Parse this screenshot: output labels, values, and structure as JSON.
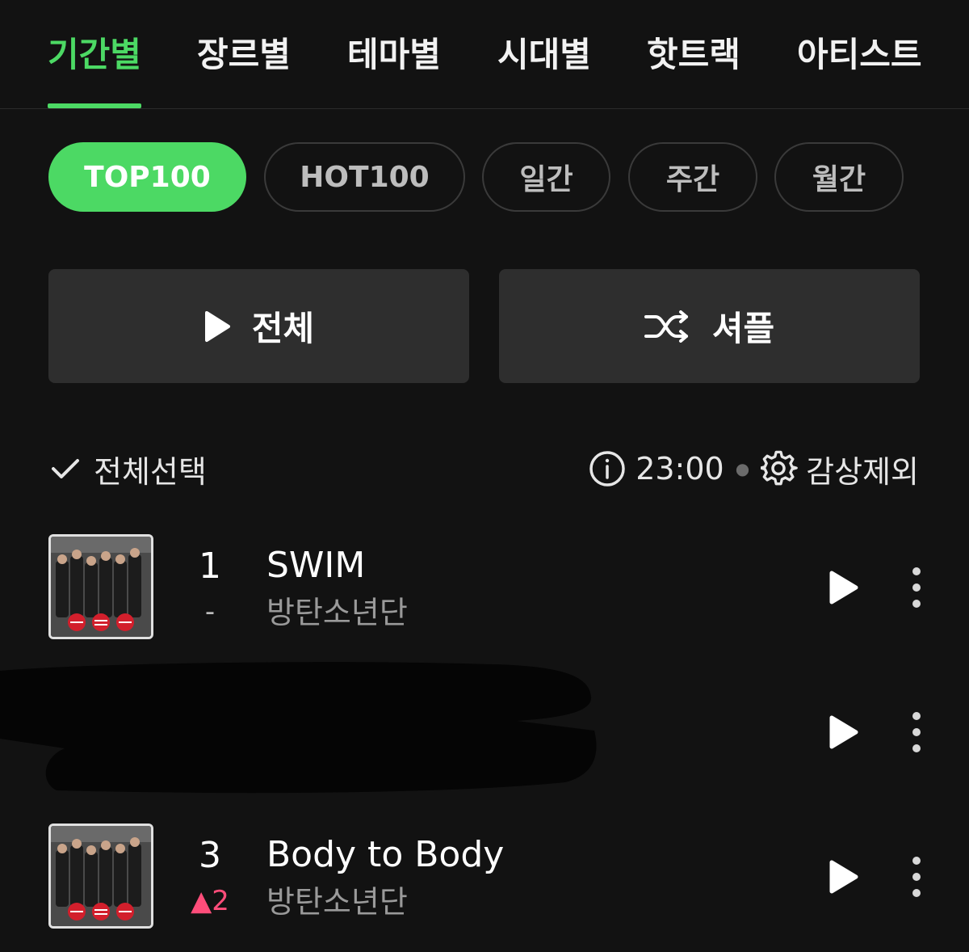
{
  "top_tabs": [
    {
      "label": "기간별",
      "active": true
    },
    {
      "label": "장르별",
      "active": false
    },
    {
      "label": "테마별",
      "active": false
    },
    {
      "label": "시대별",
      "active": false
    },
    {
      "label": "핫트랙",
      "active": false
    },
    {
      "label": "아티스트",
      "active": false
    }
  ],
  "chips": [
    {
      "label": "TOP100",
      "active": true
    },
    {
      "label": "HOT100",
      "active": false
    },
    {
      "label": "일간",
      "active": false
    },
    {
      "label": "주간",
      "active": false
    },
    {
      "label": "월간",
      "active": false
    }
  ],
  "actions": {
    "play_all": {
      "label": "전체",
      "icon": "play-icon"
    },
    "shuffle": {
      "label": "셔플",
      "icon": "shuffle-icon"
    }
  },
  "list_header": {
    "select_all_label": "전체선택",
    "update_time": "23:00",
    "exclude_label": "감상제외"
  },
  "tracks": [
    {
      "rank": "1",
      "change": "-",
      "change_dir": "none",
      "title": "SWIM",
      "artist": "방탄소년단"
    },
    {
      "rank": "",
      "change": "",
      "change_dir": "none",
      "title": "",
      "artist": "",
      "redacted": true
    },
    {
      "rank": "3",
      "change": "▲2",
      "change_dir": "up",
      "title": "Body to Body",
      "artist": "방탄소년단"
    }
  ],
  "colors": {
    "accent": "#4cd964",
    "background": "#121212",
    "button_bg": "#2e2e2e",
    "rank_up": "#ff4d7a"
  }
}
